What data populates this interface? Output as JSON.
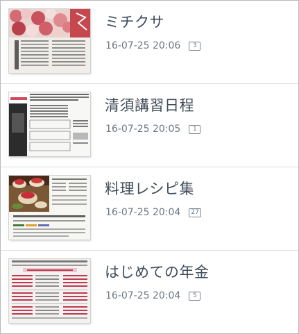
{
  "documents": [
    {
      "title": "ミチクサ",
      "date": "16-07-25 20:06",
      "pages": "3",
      "thumbnail_icon": "magazine-page-thumbnail"
    },
    {
      "title": "清須講習日程",
      "date": "16-07-25 20:05",
      "pages": "1",
      "thumbnail_icon": "tablet-class-schedule-thumbnail"
    },
    {
      "title": "料理レシピ集",
      "date": "16-07-25 20:04",
      "pages": "27",
      "thumbnail_icon": "recipe-page-thumbnail"
    },
    {
      "title": "はじめての年金",
      "date": "16-07-25 20:04",
      "pages": "5",
      "thumbnail_icon": "pension-table-thumbnail"
    }
  ],
  "colors": {
    "title_text": "#3f4c59",
    "meta_text": "#6e7781",
    "divider": "#dcdcdc",
    "frame_border": "#b9b9b9"
  }
}
